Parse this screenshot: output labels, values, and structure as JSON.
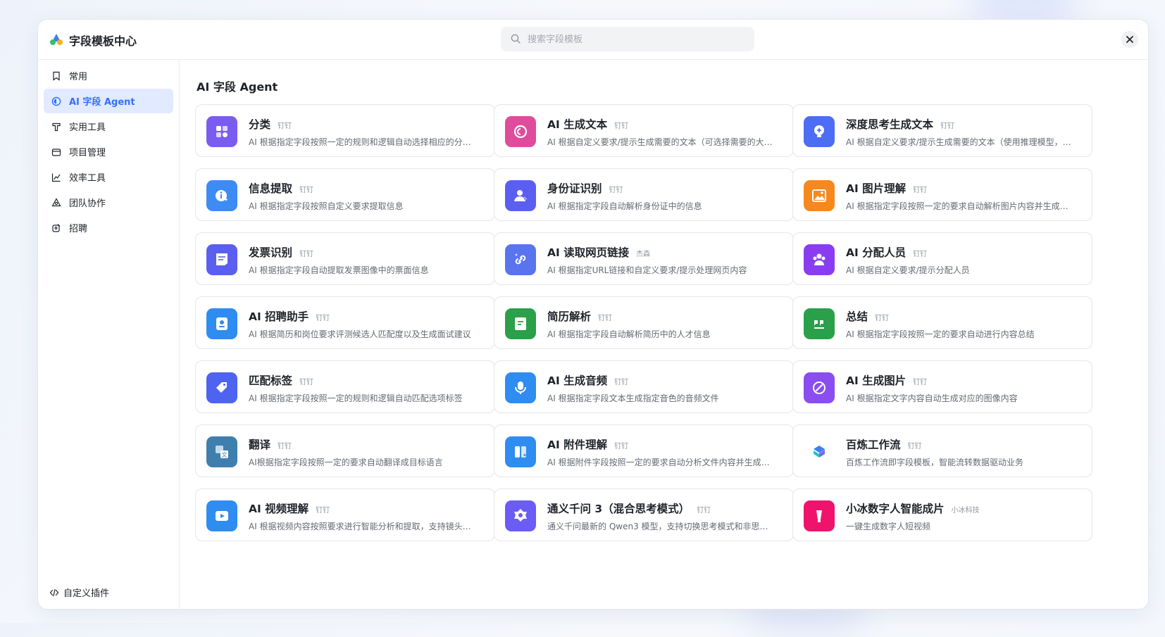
{
  "header": {
    "title": "字段模板中心",
    "search_placeholder": "搜索字段模板"
  },
  "sidebar": {
    "items": [
      {
        "label": "常用",
        "icon": "bookmark-icon"
      },
      {
        "label": "AI 字段 Agent",
        "icon": "ai-circle-icon",
        "active": true
      },
      {
        "label": "实用工具",
        "icon": "pin-icon"
      },
      {
        "label": "项目管理",
        "icon": "folder-icon"
      },
      {
        "label": "效率工具",
        "icon": "chart-line-icon"
      },
      {
        "label": "团队协作",
        "icon": "team-icon"
      },
      {
        "label": "招聘",
        "icon": "recruit-icon"
      }
    ],
    "footer_label": "自定义插件"
  },
  "main": {
    "section_title": "AI 字段 Agent",
    "cards": [
      {
        "name": "分类",
        "tag": "钉钉",
        "desc": "AI 根据指定字段按照一定的规则和逻辑自动选择相应的分类...",
        "icon": "category-icon",
        "color": "#7b5cf0"
      },
      {
        "name": "AI 生成文本",
        "tag": "钉钉",
        "desc": "AI 根据自定义要求/提示生成需要的文本（可选择需要的大模型...",
        "icon": "ai-text-icon",
        "color": "#e04c9c"
      },
      {
        "name": "深度思考生成文本",
        "tag": "钉钉",
        "desc": "AI 根据自定义要求/提示生成需要的文本（使用推理模型，可...",
        "icon": "bulb-icon",
        "color": "#4d6df5"
      },
      {
        "name": "信息提取",
        "tag": "钉钉",
        "desc": "AI 根据指定字段按照自定义要求提取信息",
        "icon": "info-icon",
        "color": "#3d8bf5"
      },
      {
        "name": "身份证识别",
        "tag": "钉钉",
        "desc": "AI 根据指定字段自动解析身份证中的信息",
        "icon": "person-icon",
        "color": "#5b5ff0"
      },
      {
        "name": "AI 图片理解",
        "tag": "钉钉",
        "desc": "AI 根据指定字段按照一定的要求自动解析图片内容并生成文本",
        "icon": "image-icon",
        "color": "#f5881f"
      },
      {
        "name": "发票识别",
        "tag": "钉钉",
        "desc": "AI 根据指定字段自动提取发票图像中的票面信息",
        "icon": "invoice-icon",
        "color": "#5b5ff0"
      },
      {
        "name": "AI 读取网页链接",
        "tag": "杰森",
        "desc": "AI 根据指定URL链接和自定义要求/提示处理网页内容",
        "icon": "link-icon",
        "color": "#5a74ee"
      },
      {
        "name": "AI 分配人员",
        "tag": "钉钉",
        "desc": "AI 根据自定义要求/提示分配人员",
        "icon": "people-icon",
        "color": "#8a3df0"
      },
      {
        "name": "AI 招聘助手",
        "tag": "钉钉",
        "desc": "AI 根据简历和岗位要求评测候选人匹配度以及生成面试建议",
        "icon": "resume-icon",
        "color": "#2f8cf0"
      },
      {
        "name": "简历解析",
        "tag": "钉钉",
        "desc": "AI 根据指定字段自动解析简历中的人才信息",
        "icon": "doc-icon",
        "color": "#2aa04a"
      },
      {
        "name": "总结",
        "tag": "钉钉",
        "desc": "AI 根据指定字段按照一定的要求自动进行内容总结",
        "icon": "quote-icon",
        "color": "#2aa04a"
      },
      {
        "name": "匹配标签",
        "tag": "钉钉",
        "desc": "AI 根据指定字段按照一定的规则和逻辑自动匹配选项标签",
        "icon": "tag-icon",
        "color": "#4e63ef"
      },
      {
        "name": "AI 生成音频",
        "tag": "钉钉",
        "desc": "AI 根据指定字段文本生成指定音色的音频文件",
        "icon": "mic-icon",
        "color": "#2f8cf0"
      },
      {
        "name": "AI 生成图片",
        "tag": "钉钉",
        "desc": "AI 根据指定文字内容自动生成对应的图像内容",
        "icon": "paint-icon",
        "color": "#8a4df0"
      },
      {
        "name": "翻译",
        "tag": "钉钉",
        "desc": "AI根据指定字段按照一定的要求自动翻译成目标语言",
        "icon": "translate-icon",
        "color": "#3f7fae"
      },
      {
        "name": "AI 附件理解",
        "tag": "钉钉",
        "desc": "AI 根据附件字段按照一定的要求自动分析文件内容并生成文本",
        "icon": "attachment-icon",
        "color": "#2f8cf0"
      },
      {
        "name": "百炼工作流",
        "tag": "钉钉",
        "desc": "百炼工作流即字段模板，智能流转数据驱动业务",
        "icon": "bailian-logo-icon",
        "color": "#ffffff"
      },
      {
        "name": "AI 视频理解",
        "tag": "钉钉",
        "desc": "AI 根据视频内容按照要求进行智能分析和提取，支持镜头识...",
        "icon": "video-icon",
        "color": "#2f8cf0"
      },
      {
        "name": "通义千问 3（混合思考模式）",
        "tag": "钉钉",
        "desc": "通义千问最新的 Qwen3 模型，支持切换思考模式和非思考模...",
        "icon": "qwen-logo-icon",
        "color": "#6a5cf5"
      },
      {
        "name": "小冰数字人智能成片",
        "tag": "小冰科技",
        "desc": "一键生成数字人短视频",
        "icon": "xiaoice-logo-icon",
        "color": "#f0136c"
      }
    ]
  }
}
